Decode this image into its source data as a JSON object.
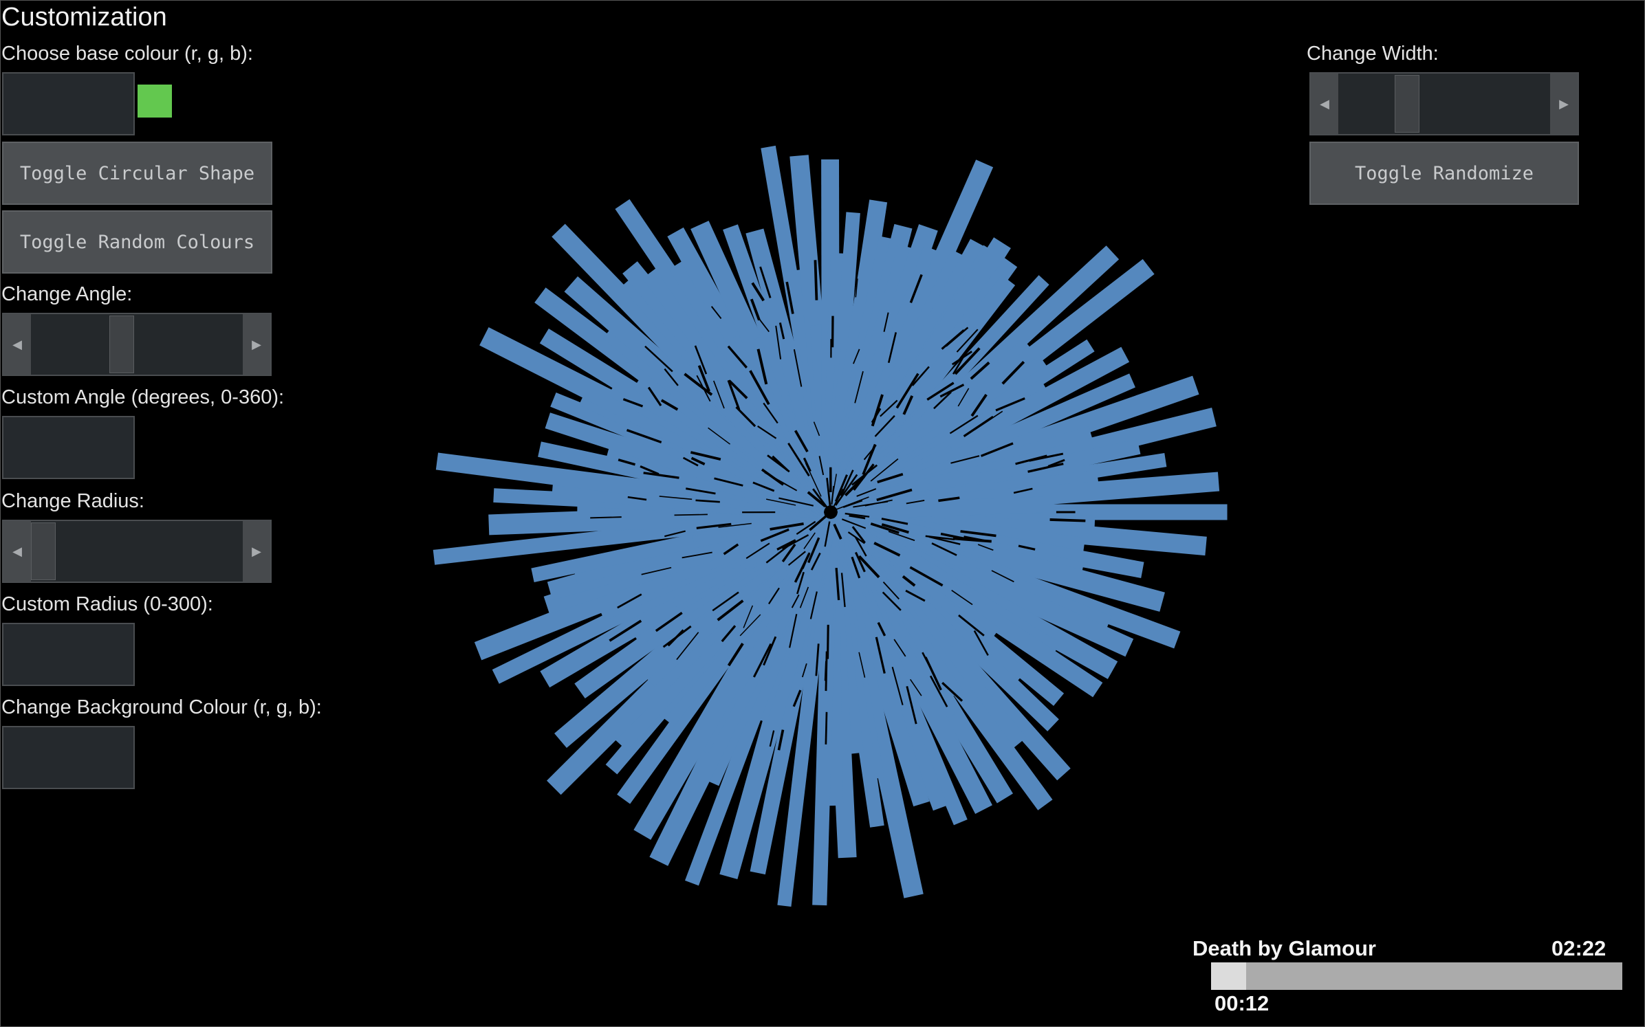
{
  "panel": {
    "title": "Customization",
    "base_colour_label": "Choose base colour (r, g, b):",
    "base_colour_value": "",
    "base_colour_swatch": "#63c84f",
    "toggle_circular_label": "Toggle Circular Shape",
    "toggle_random_colours_label": "Toggle Random Colours",
    "change_angle_label": "Change Angle:",
    "change_angle_value": 0.42,
    "custom_angle_label": "Custom Angle (degrees, 0-360):",
    "custom_angle_value": "",
    "change_radius_label": "Change Radius:",
    "change_radius_value": 0.0,
    "custom_radius_label": "Custom Radius (0-300):",
    "custom_radius_value": "",
    "bg_colour_label": "Change Background Colour (r, g, b):",
    "bg_colour_value": ""
  },
  "right_panel": {
    "change_width_label": "Change Width:",
    "change_width_value": 0.3,
    "toggle_randomize_label": "Toggle Randomize"
  },
  "visualizer": {
    "bar_colour": "#5588be"
  },
  "player": {
    "track_title": "Death by Glamour",
    "duration": "02:22",
    "elapsed": "00:12",
    "progress": 0.085
  },
  "icons": {
    "slider_left": "arrow-left-icon",
    "slider_right": "arrow-right-icon"
  }
}
